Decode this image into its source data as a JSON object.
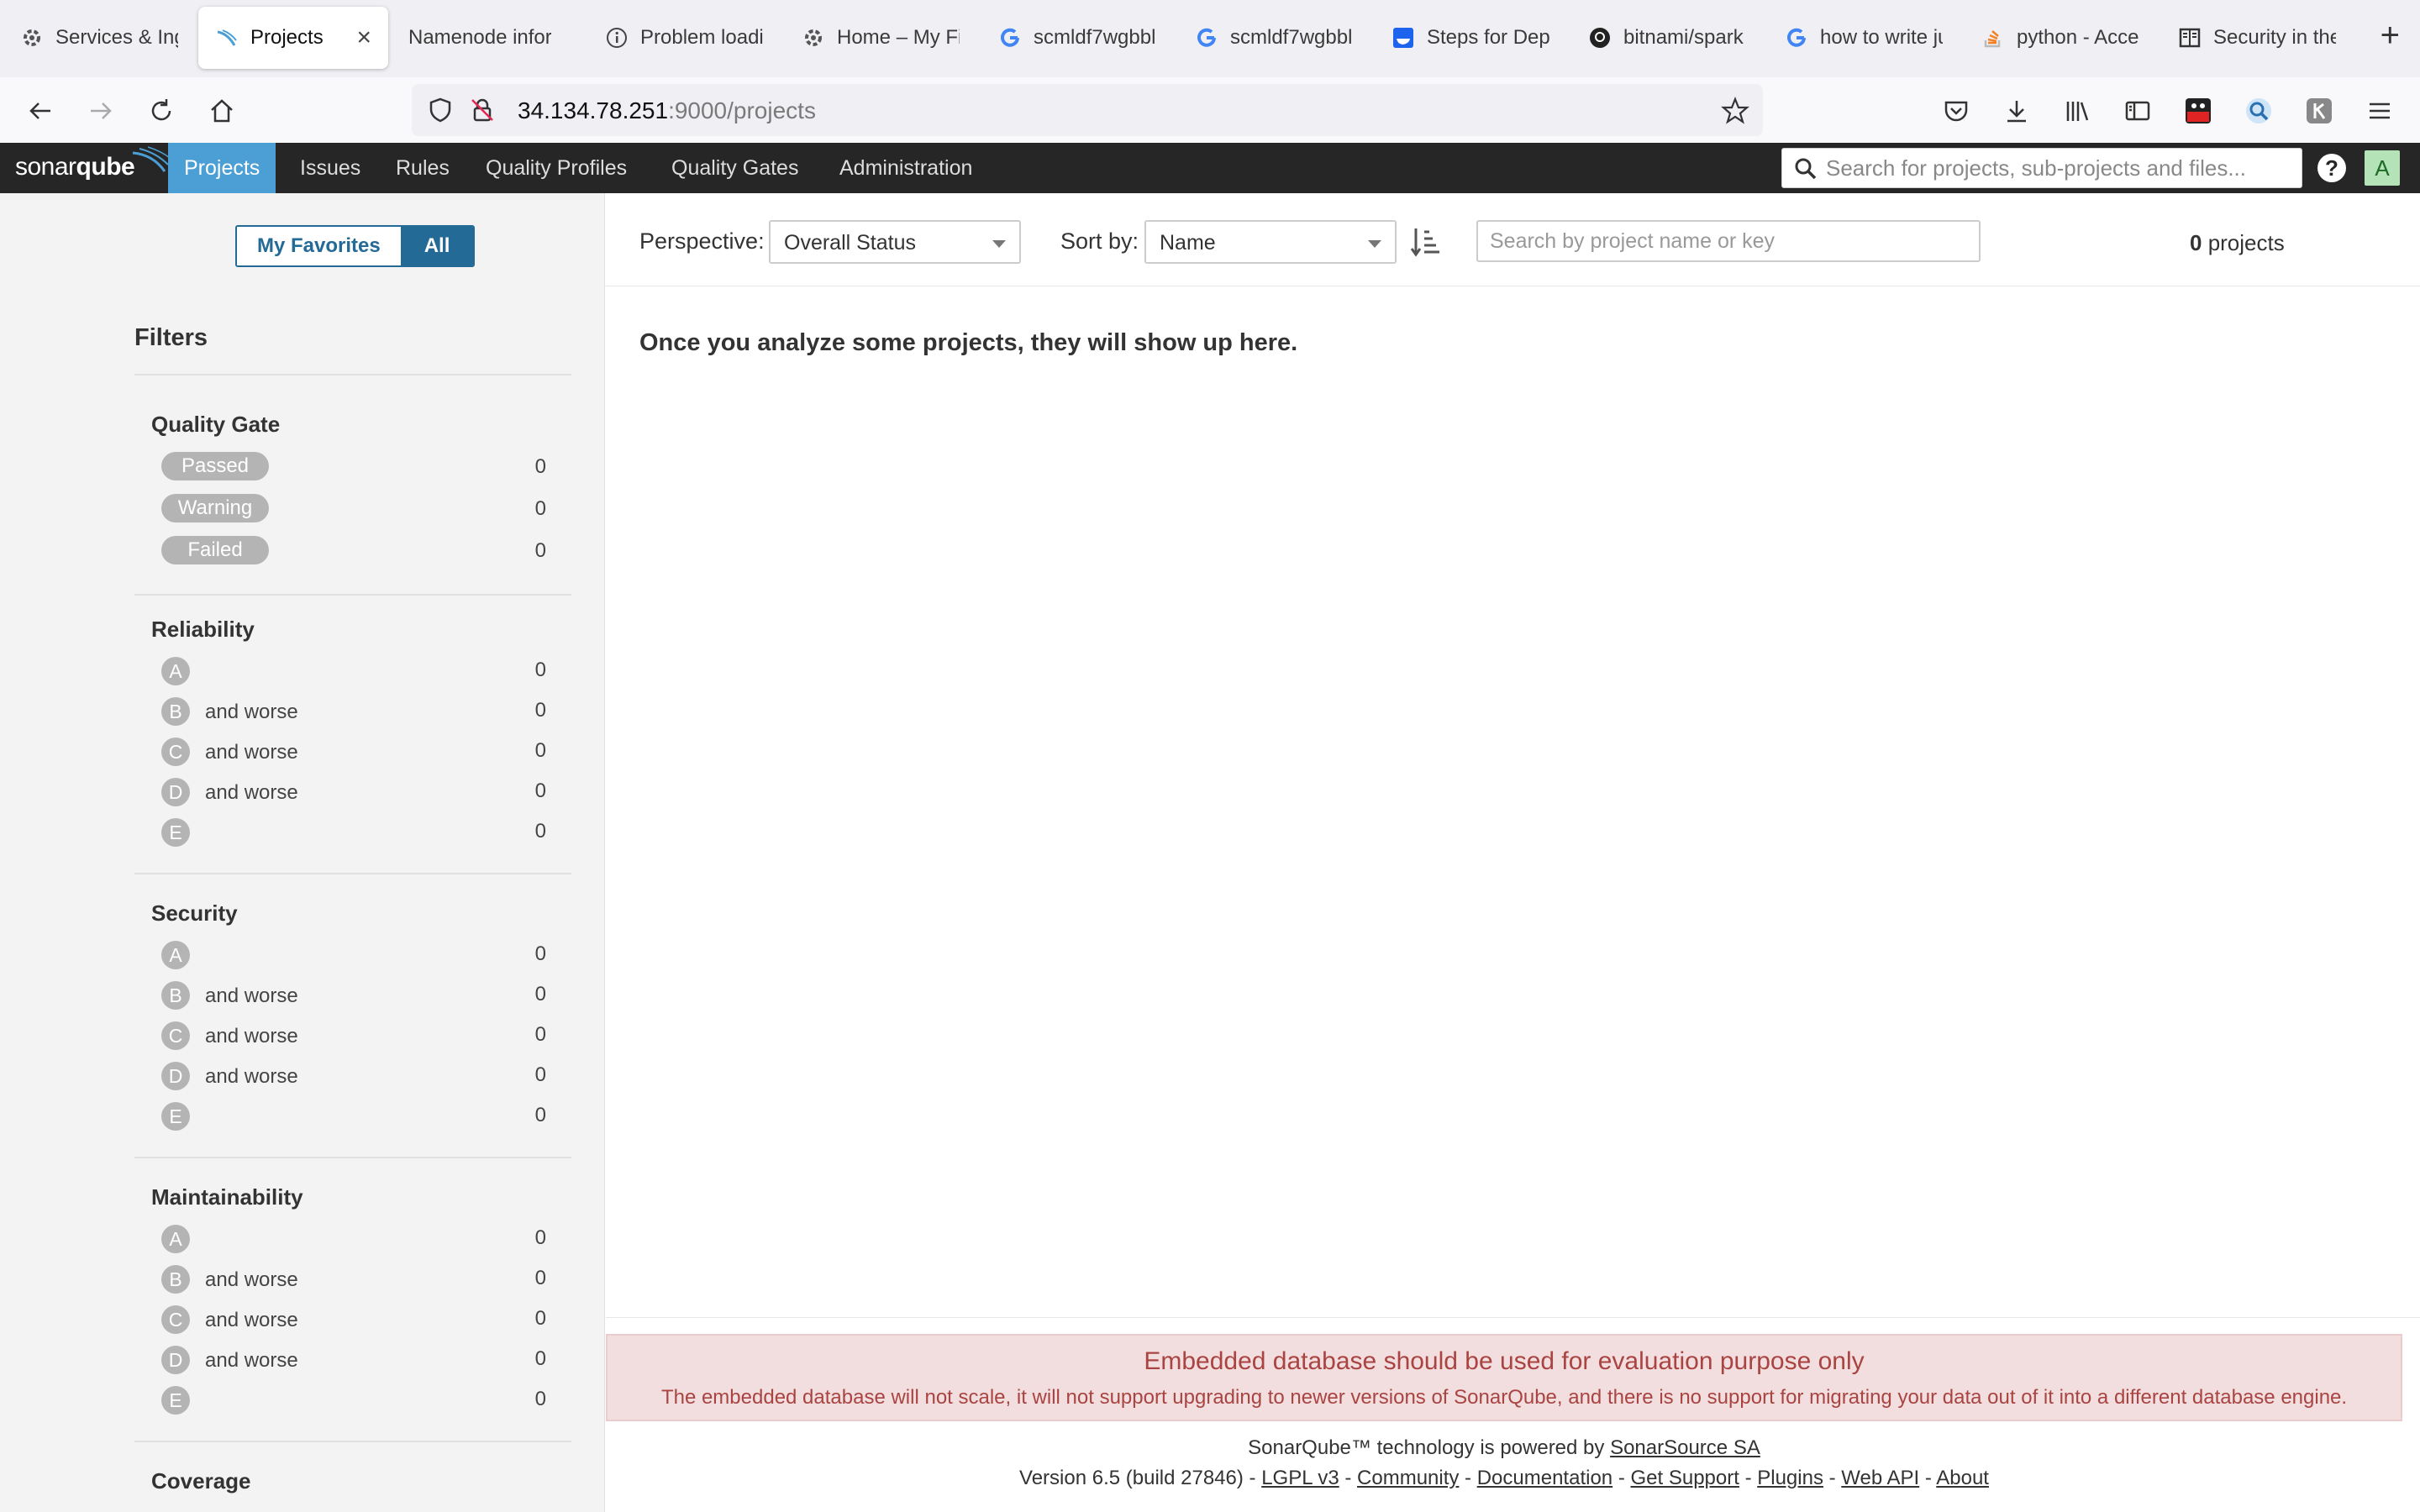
{
  "browser": {
    "tabs": [
      {
        "title": "Services & Ingr",
        "icon": "gear-icon"
      },
      {
        "title": "Projects",
        "icon": "sonarqube-icon",
        "active": true
      },
      {
        "title": "Namenode inform",
        "icon": "none"
      },
      {
        "title": "Problem loadi",
        "icon": "info-icon"
      },
      {
        "title": "Home – My Fi",
        "icon": "gear-icon"
      },
      {
        "title": "scmldf7wgbbl",
        "icon": "google-icon"
      },
      {
        "title": "scmldf7wgbbl",
        "icon": "google-icon"
      },
      {
        "title": "Steps for Depl",
        "icon": "docker-icon"
      },
      {
        "title": "bitnami/spark",
        "icon": "github-icon"
      },
      {
        "title": "how to write ju",
        "icon": "google-icon"
      },
      {
        "title": "python - Acce",
        "icon": "stackoverflow-icon"
      },
      {
        "title": "Security in the",
        "icon": "book-icon"
      }
    ],
    "url_host": "34.134.78.251",
    "url_path": ":9000/projects"
  },
  "sq": {
    "logo_light": "sonar",
    "logo_bold": "qube",
    "nav": [
      "Projects",
      "Issues",
      "Rules",
      "Quality Profiles",
      "Quality Gates",
      "Administration"
    ],
    "search_placeholder": "Search for projects, sub-projects and files...",
    "help": "?",
    "avatar": "A",
    "colors": {
      "header": "#262626",
      "active_nav": "#4b9fd5",
      "alert_bg": "#f2dede",
      "alert_text": "#a94442"
    }
  },
  "sidebar": {
    "fav_label": "My Favorites",
    "all_label": "All",
    "filters_title": "Filters",
    "quality_gate": {
      "title": "Quality Gate",
      "rows": [
        {
          "label": "Passed",
          "count": "0"
        },
        {
          "label": "Warning",
          "count": "0"
        },
        {
          "label": "Failed",
          "count": "0"
        }
      ]
    },
    "reliability": {
      "title": "Reliability",
      "rows": [
        {
          "rating": "A",
          "text": "",
          "count": "0"
        },
        {
          "rating": "B",
          "text": "and worse",
          "count": "0"
        },
        {
          "rating": "C",
          "text": "and worse",
          "count": "0"
        },
        {
          "rating": "D",
          "text": "and worse",
          "count": "0"
        },
        {
          "rating": "E",
          "text": "",
          "count": "0"
        }
      ]
    },
    "security": {
      "title": "Security",
      "rows": [
        {
          "rating": "A",
          "text": "",
          "count": "0"
        },
        {
          "rating": "B",
          "text": "and worse",
          "count": "0"
        },
        {
          "rating": "C",
          "text": "and worse",
          "count": "0"
        },
        {
          "rating": "D",
          "text": "and worse",
          "count": "0"
        },
        {
          "rating": "E",
          "text": "",
          "count": "0"
        }
      ]
    },
    "maintainability": {
      "title": "Maintainability",
      "rows": [
        {
          "rating": "A",
          "text": "",
          "count": "0"
        },
        {
          "rating": "B",
          "text": "and worse",
          "count": "0"
        },
        {
          "rating": "C",
          "text": "and worse",
          "count": "0"
        },
        {
          "rating": "D",
          "text": "and worse",
          "count": "0"
        },
        {
          "rating": "E",
          "text": "",
          "count": "0"
        }
      ]
    },
    "coverage_title": "Coverage"
  },
  "main": {
    "perspective_label": "Perspective:",
    "perspective_value": "Overall Status",
    "sort_label": "Sort by:",
    "sort_value": "Name",
    "search_placeholder": "Search by project name or key",
    "count_num": "0",
    "count_text": " projects",
    "empty_message": "Once you analyze some projects, they will show up here."
  },
  "alert": {
    "title": "Embedded database should be used for evaluation purpose only",
    "text": "The embedded database will not scale, it will not support upgrading to newer versions of SonarQube, and there is no support for migrating your data out of it into a different database engine."
  },
  "footer": {
    "powered_prefix": "SonarQube™ technology is powered by ",
    "powered_link": "SonarSource SA",
    "version": "Version 6.5 (build 27846)",
    "links": [
      "LGPL v3",
      "Community",
      "Documentation",
      "Get Support",
      "Plugins",
      "Web API",
      "About"
    ]
  }
}
